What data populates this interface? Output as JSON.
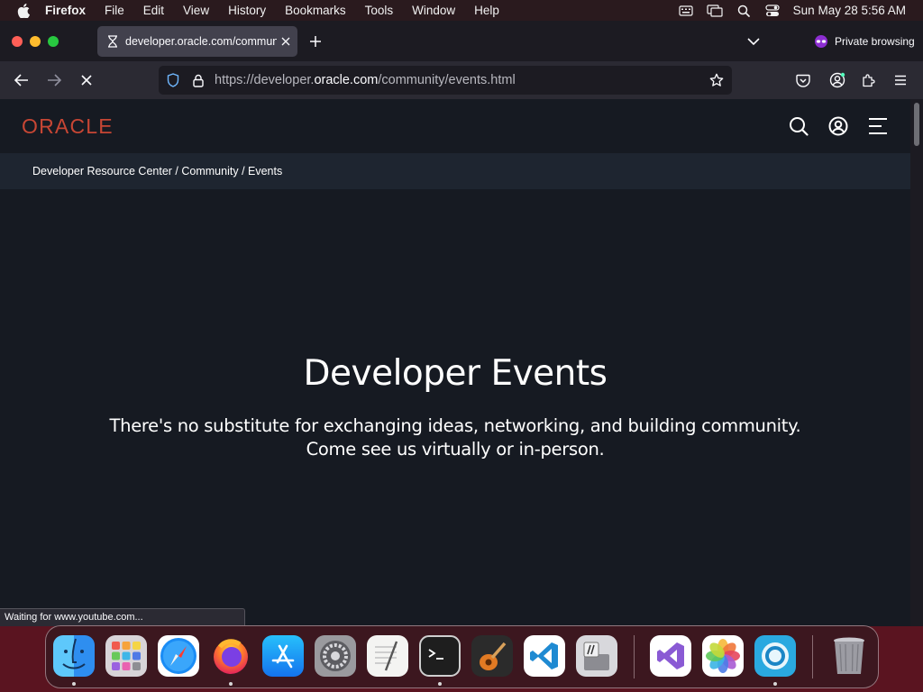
{
  "menubar": {
    "app_name": "Firefox",
    "items": [
      "File",
      "Edit",
      "View",
      "History",
      "Bookmarks",
      "Tools",
      "Window",
      "Help"
    ],
    "clock": "Sun May 28  5:56 AM"
  },
  "browser": {
    "tab": {
      "title": "developer.oracle.com/communit"
    },
    "private_label": "Private browsing",
    "url": {
      "prefix": "https://developer.",
      "domain": "oracle.com",
      "path": "/community/events.html"
    },
    "status_text": "Waiting for www.youtube.com..."
  },
  "page": {
    "logo": "ORACLE",
    "logo_color": "#c74634",
    "breadcrumb": [
      "Developer Resource Center",
      "Community",
      "Events"
    ],
    "breadcrumb_separator": " / ",
    "hero_title": "Developer Events",
    "hero_subtitle_line1": "There's no substitute for exchanging ideas, networking, and building community.",
    "hero_subtitle_line2": "Come see us virtually or in-person."
  },
  "dock": {
    "items": [
      "finder",
      "launchpad",
      "safari",
      "firefox",
      "app-store",
      "system-preferences",
      "textedit",
      "terminal",
      "garageband",
      "vscode",
      "migration-assistant",
      "visual-studio",
      "photos",
      "alto",
      "trash"
    ]
  }
}
